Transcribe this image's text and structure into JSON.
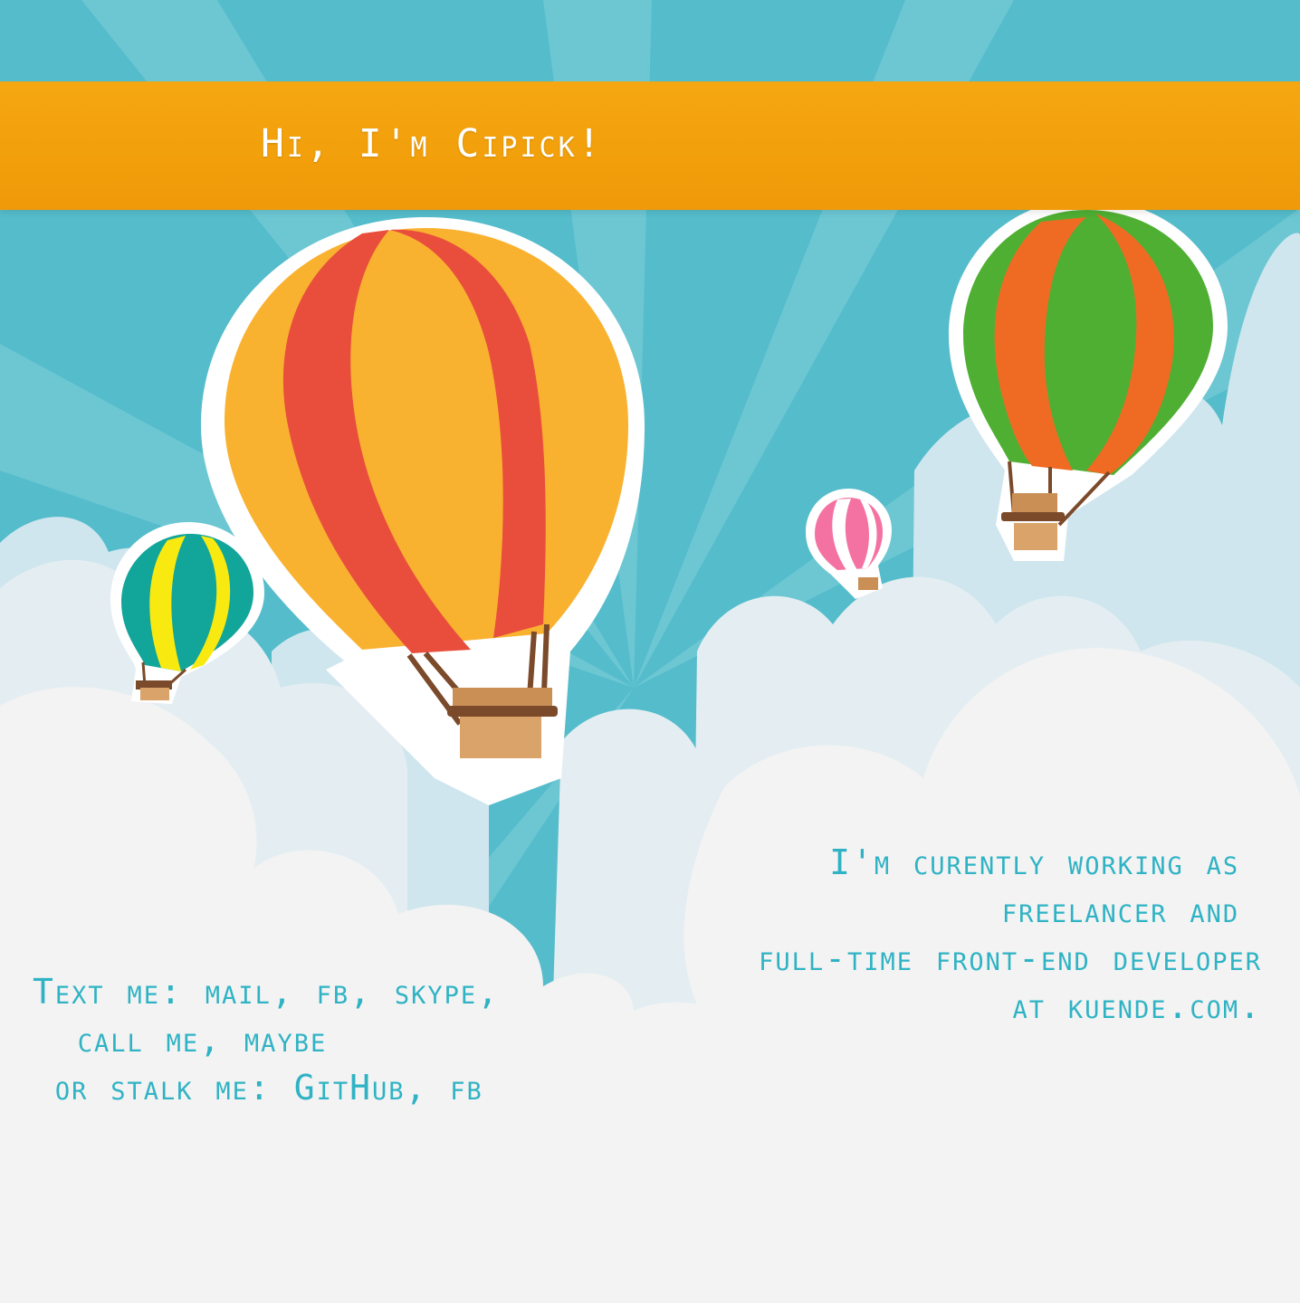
{
  "header": {
    "title": "Hi, I'm Cipick!"
  },
  "work": {
    "line1": "I'm curently working as ",
    "line2": "freelancer and ",
    "line3": "full-time front-end developer",
    "line4_prefix": "at ",
    "company_link": "kuende.com",
    "line4_suffix": "."
  },
  "contact": {
    "line1_prefix": "Text me: ",
    "mail_link": "mail",
    "sep1": ", ",
    "fb_link": "fb",
    "sep2": ", ",
    "skype_link": "skype",
    "sep3": ",",
    "line2_prefix": "  ",
    "call_link": "call me, maybe",
    "line3_prefix": " or stalk me: ",
    "github_link": "GitHub",
    "sep4": ", ",
    "fb2_link": "fb"
  },
  "colors": {
    "sky": "#55bccb",
    "banner": "#f2a00b",
    "text_accent": "#2fb3c4",
    "cloud": "#f2f2f2"
  },
  "icons": [
    "hot-air-balloon-large",
    "hot-air-balloon-green",
    "hot-air-balloon-teal",
    "hot-air-balloon-pink"
  ]
}
